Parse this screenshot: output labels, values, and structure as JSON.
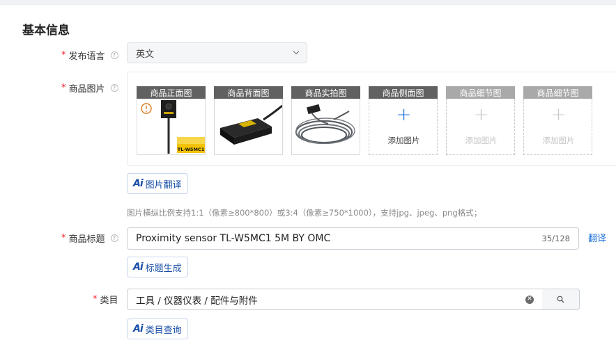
{
  "section": {
    "title": "基本信息"
  },
  "language": {
    "label": "发布语言",
    "value": "英文"
  },
  "images": {
    "label": "商品图片",
    "slots": [
      {
        "header": "商品正面图",
        "state": "filled",
        "badge_text": "TL-W5MC1"
      },
      {
        "header": "商品背面图",
        "state": "filled"
      },
      {
        "header": "商品实拍图",
        "state": "filled"
      },
      {
        "header": "商品侧面图",
        "state": "empty",
        "add_text": "添加图片"
      },
      {
        "header": "商品细节图",
        "state": "disabled",
        "add_text": "添加图片"
      },
      {
        "header": "商品细节图",
        "state": "disabled",
        "add_text": "添加图片"
      }
    ],
    "translate_button": "图片翻译",
    "hint": "图片横纵比例支持1:1（像素≥800*800）或3:4（像素≥750*1000），支持jpg、jpeg、png格式；"
  },
  "title_field": {
    "label": "商品标题",
    "value": "Proximity sensor TL-W5MC1 5M BY OMC",
    "count": "35/128",
    "translate_link": "翻译",
    "generate_button": "标题生成"
  },
  "category": {
    "label": "类目",
    "value": "工具 / 仪器仪表 / 配件与附件",
    "query_button": "类目查询"
  },
  "ai_mark": "Ai",
  "required_mark": "*",
  "colors": {
    "accent": "#1a6fd8",
    "ai": "#1a4fa8",
    "required": "#f5222d",
    "header_bg": "#616161"
  },
  "icons": [
    "help-icon",
    "chevron-down-icon",
    "warning-icon",
    "plus-icon",
    "clear-icon",
    "search-icon"
  ]
}
